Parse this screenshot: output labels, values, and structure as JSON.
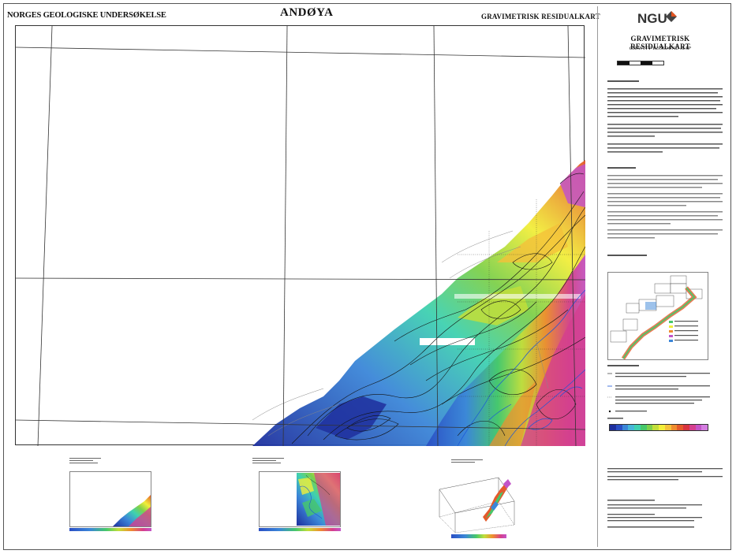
{
  "header": {
    "left_title": "NORGES GEOLOGISKE UNDERSØKELSE",
    "map_title": "ANDØYA",
    "right_title": "GRAVIMETRISK RESIDUALKART"
  },
  "panel": {
    "logo": "NGU",
    "title": "GRAVIMETRISK RESIDUALKART",
    "subtitle": "GRAVITY RESIDUAL MAP"
  },
  "colors": {
    "ramp": [
      "#1e2f9e",
      "#2a4fc4",
      "#3b86d8",
      "#46b6d8",
      "#3fd1b0",
      "#46c86a",
      "#7ed04a",
      "#c2de3a",
      "#f2ee3a",
      "#f4c13a",
      "#ef8d2f",
      "#e45a2b",
      "#d8343f",
      "#d53f8e",
      "#c354c8",
      "#d47de0"
    ],
    "sheet_border": "#555555",
    "grid": "#333333"
  }
}
